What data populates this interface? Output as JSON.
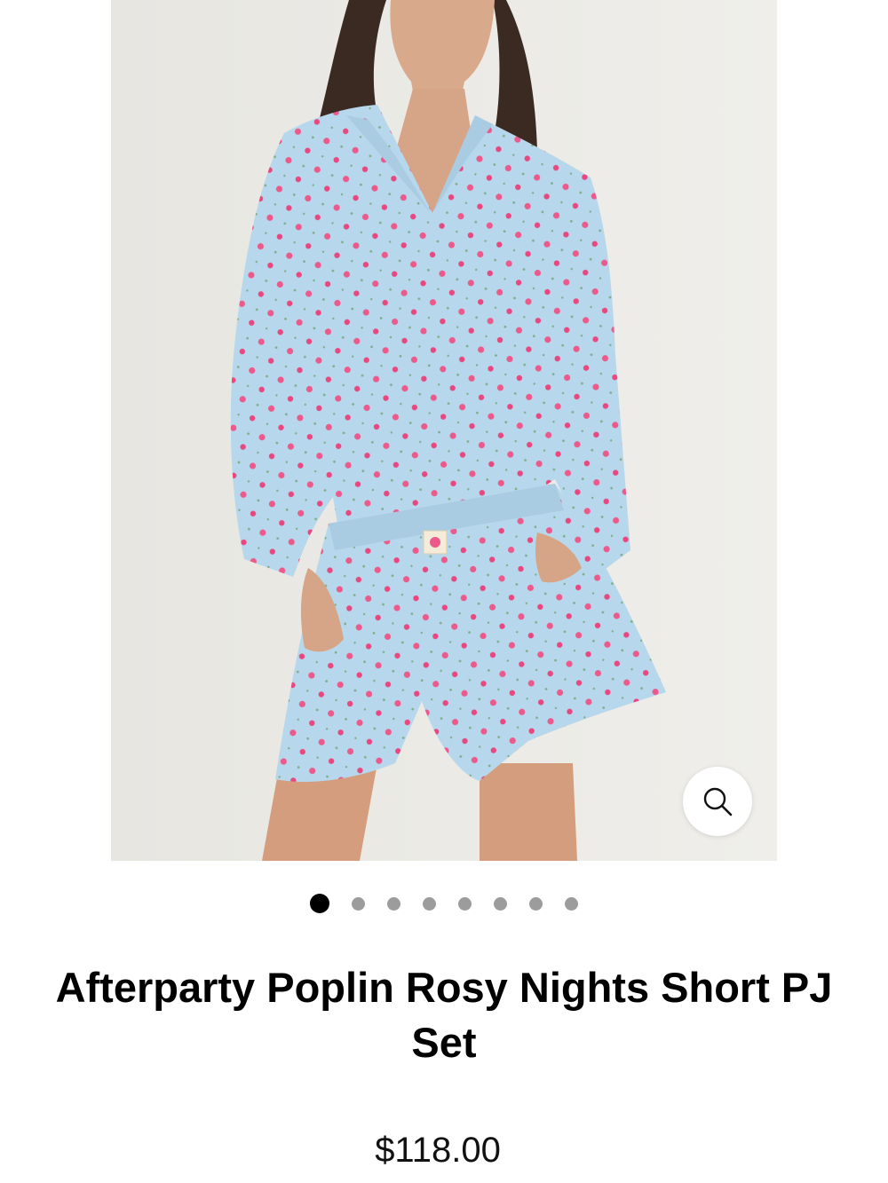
{
  "product": {
    "image_alt": "Model wearing light blue pyjama set with pink rose print",
    "title": "Afterparty Poplin Rosy Nights Short PJ Set",
    "price": "$118.00"
  },
  "gallery": {
    "image_count": 8,
    "active_index": 0
  },
  "colors": {
    "fabric": "#b7d8ec",
    "print": "#ec5a8c",
    "background": "#ecebe7",
    "dot_active": "#000000",
    "dot_inactive": "#9c9c9c"
  },
  "icons": {
    "zoom": "search-icon"
  }
}
